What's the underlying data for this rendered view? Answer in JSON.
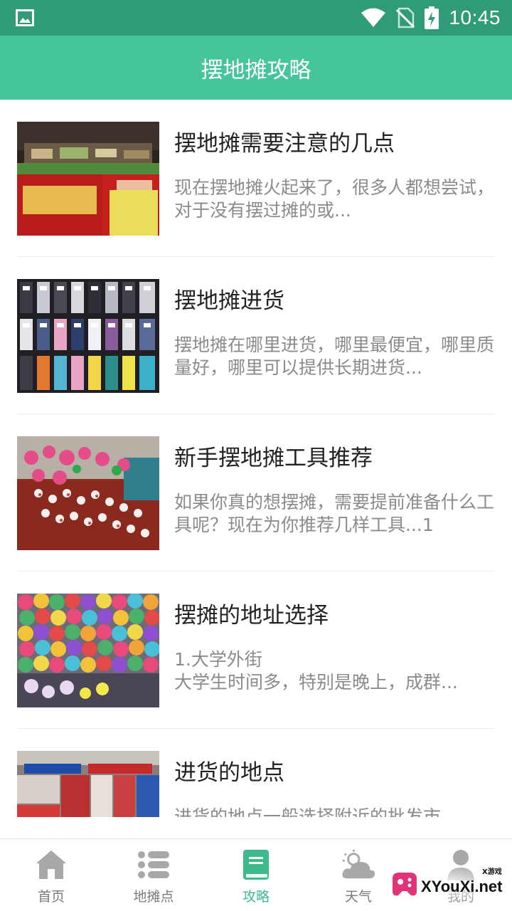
{
  "status_bar": {
    "time": "10:45",
    "icons": [
      "image-icon",
      "wifi-icon",
      "no-sim-icon",
      "battery-charging-icon"
    ]
  },
  "app_bar": {
    "title": "摆地摊攻略"
  },
  "articles": [
    {
      "title": "摆地摊需要注意的几点",
      "desc": "现在摆地摊火起来了，很多人都想尝试，对于没有摆过摊的或...",
      "thumb_icon": "street-food-cart-photo"
    },
    {
      "title": "摆地摊进货",
      "desc": "摆地摊在哪里进货，哪里最便宜，哪里质量好，哪里可以提供长期进货...",
      "thumb_icon": "socks-display-photo"
    },
    {
      "title": "新手摆地摊工具推荐",
      "desc": "如果你真的想摆摊，需要提前准备什么工具呢？现在为你推荐几样工具...1",
      "thumb_icon": "hair-accessories-stall-photo"
    },
    {
      "title": "摆摊的地址选择",
      "desc": "1.大学外街\n大学生时间多，特别是晚上，成群...",
      "thumb_icon": "balloon-wall-photo"
    },
    {
      "title": "进货的地点",
      "desc": "进货的地点一般选择附近的批发市",
      "thumb_icon": "wholesale-market-photo"
    }
  ],
  "bottom_nav": [
    {
      "label": "首页",
      "icon": "home-icon",
      "active": false
    },
    {
      "label": "地摊点",
      "icon": "list-icon",
      "active": false
    },
    {
      "label": "攻略",
      "icon": "book-icon",
      "active": true
    },
    {
      "label": "天气",
      "icon": "weather-icon",
      "active": false
    },
    {
      "label": "我的",
      "icon": "person-icon",
      "active": false
    }
  ],
  "watermark": {
    "text": "XYouXi.net",
    "small_text": "X游戏"
  },
  "colors": {
    "status_bar": "#2f9b77",
    "app_bar": "#46c59b",
    "accent": "#3db98c",
    "inactive_icon": "#a8a8a8"
  }
}
